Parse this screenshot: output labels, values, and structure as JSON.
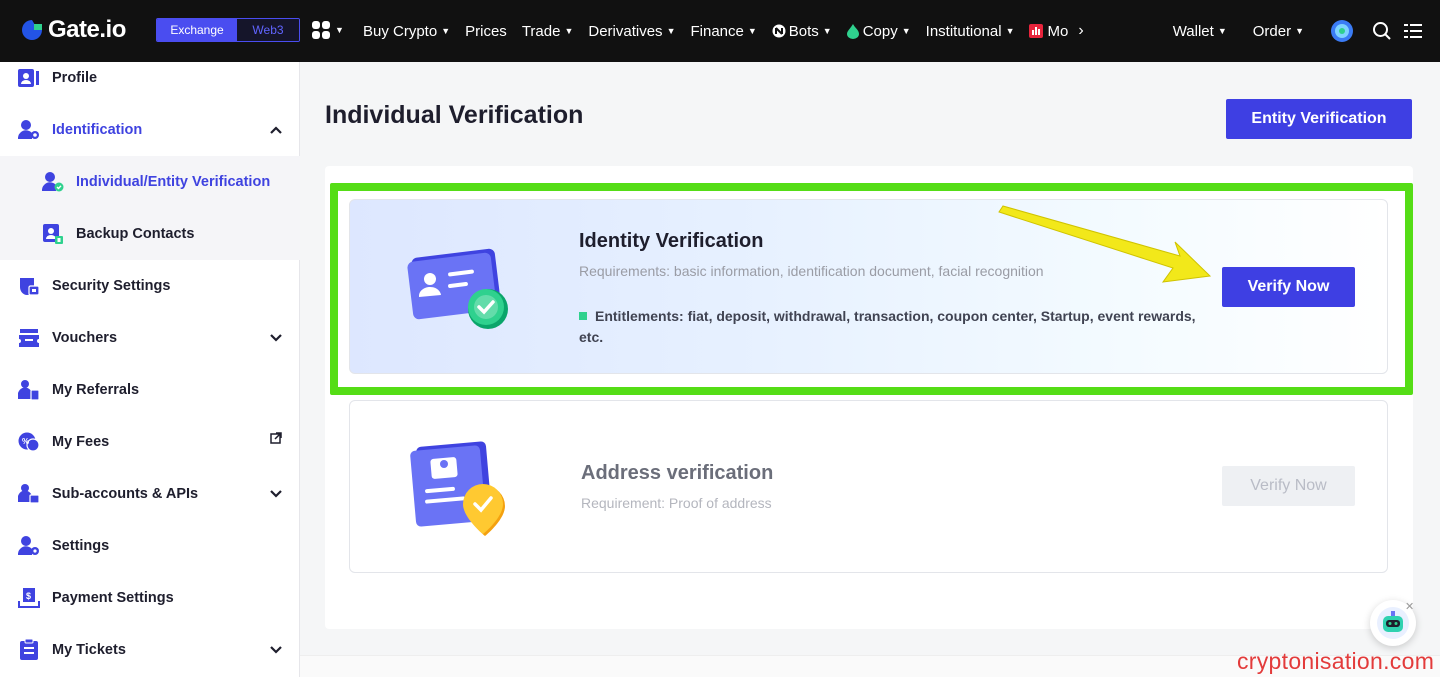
{
  "header": {
    "logo_text": "Gate.io",
    "mode_exchange": "Exchange",
    "mode_web3": "Web3",
    "nav": [
      "Buy Crypto",
      "Prices",
      "Trade",
      "Derivatives",
      "Finance",
      "Bots",
      "Copy",
      "Institutional",
      "Mo"
    ],
    "wallet": "Wallet",
    "order": "Order"
  },
  "sidebar": {
    "items": [
      {
        "label": "Profile",
        "icon": "profile-icon"
      },
      {
        "label": "Identification",
        "icon": "identification-icon"
      },
      {
        "label": "Individual/Entity Verification",
        "icon": "user-check-icon"
      },
      {
        "label": "Backup Contacts",
        "icon": "contacts-icon"
      },
      {
        "label": "Security Settings",
        "icon": "shield-icon"
      },
      {
        "label": "Vouchers",
        "icon": "voucher-icon"
      },
      {
        "label": "My Referrals",
        "icon": "referrals-icon"
      },
      {
        "label": "My Fees",
        "icon": "fees-icon"
      },
      {
        "label": "Sub-accounts & APIs",
        "icon": "sub-accounts-icon"
      },
      {
        "label": "Settings",
        "icon": "settings-icon"
      },
      {
        "label": "Payment Settings",
        "icon": "payment-icon"
      },
      {
        "label": "My Tickets",
        "icon": "tickets-icon"
      }
    ]
  },
  "main": {
    "title": "Individual Verification",
    "entity_button": "Entity Verification",
    "identity": {
      "title": "Identity Verification",
      "requirements": "Requirements: basic information, identification document, facial recognition",
      "entitlements": "Entitlements: fiat, deposit, withdrawal, transaction, coupon center, Startup, event rewards, etc.",
      "button": "Verify Now"
    },
    "address": {
      "title": "Address verification",
      "requirement": "Requirement: Proof of address",
      "button": "Verify Now"
    }
  },
  "watermark": "cryptonisation.com",
  "colors": {
    "brand": "#3e3fe3",
    "highlight": "#55dd16",
    "arrow": "#f2e81a"
  }
}
